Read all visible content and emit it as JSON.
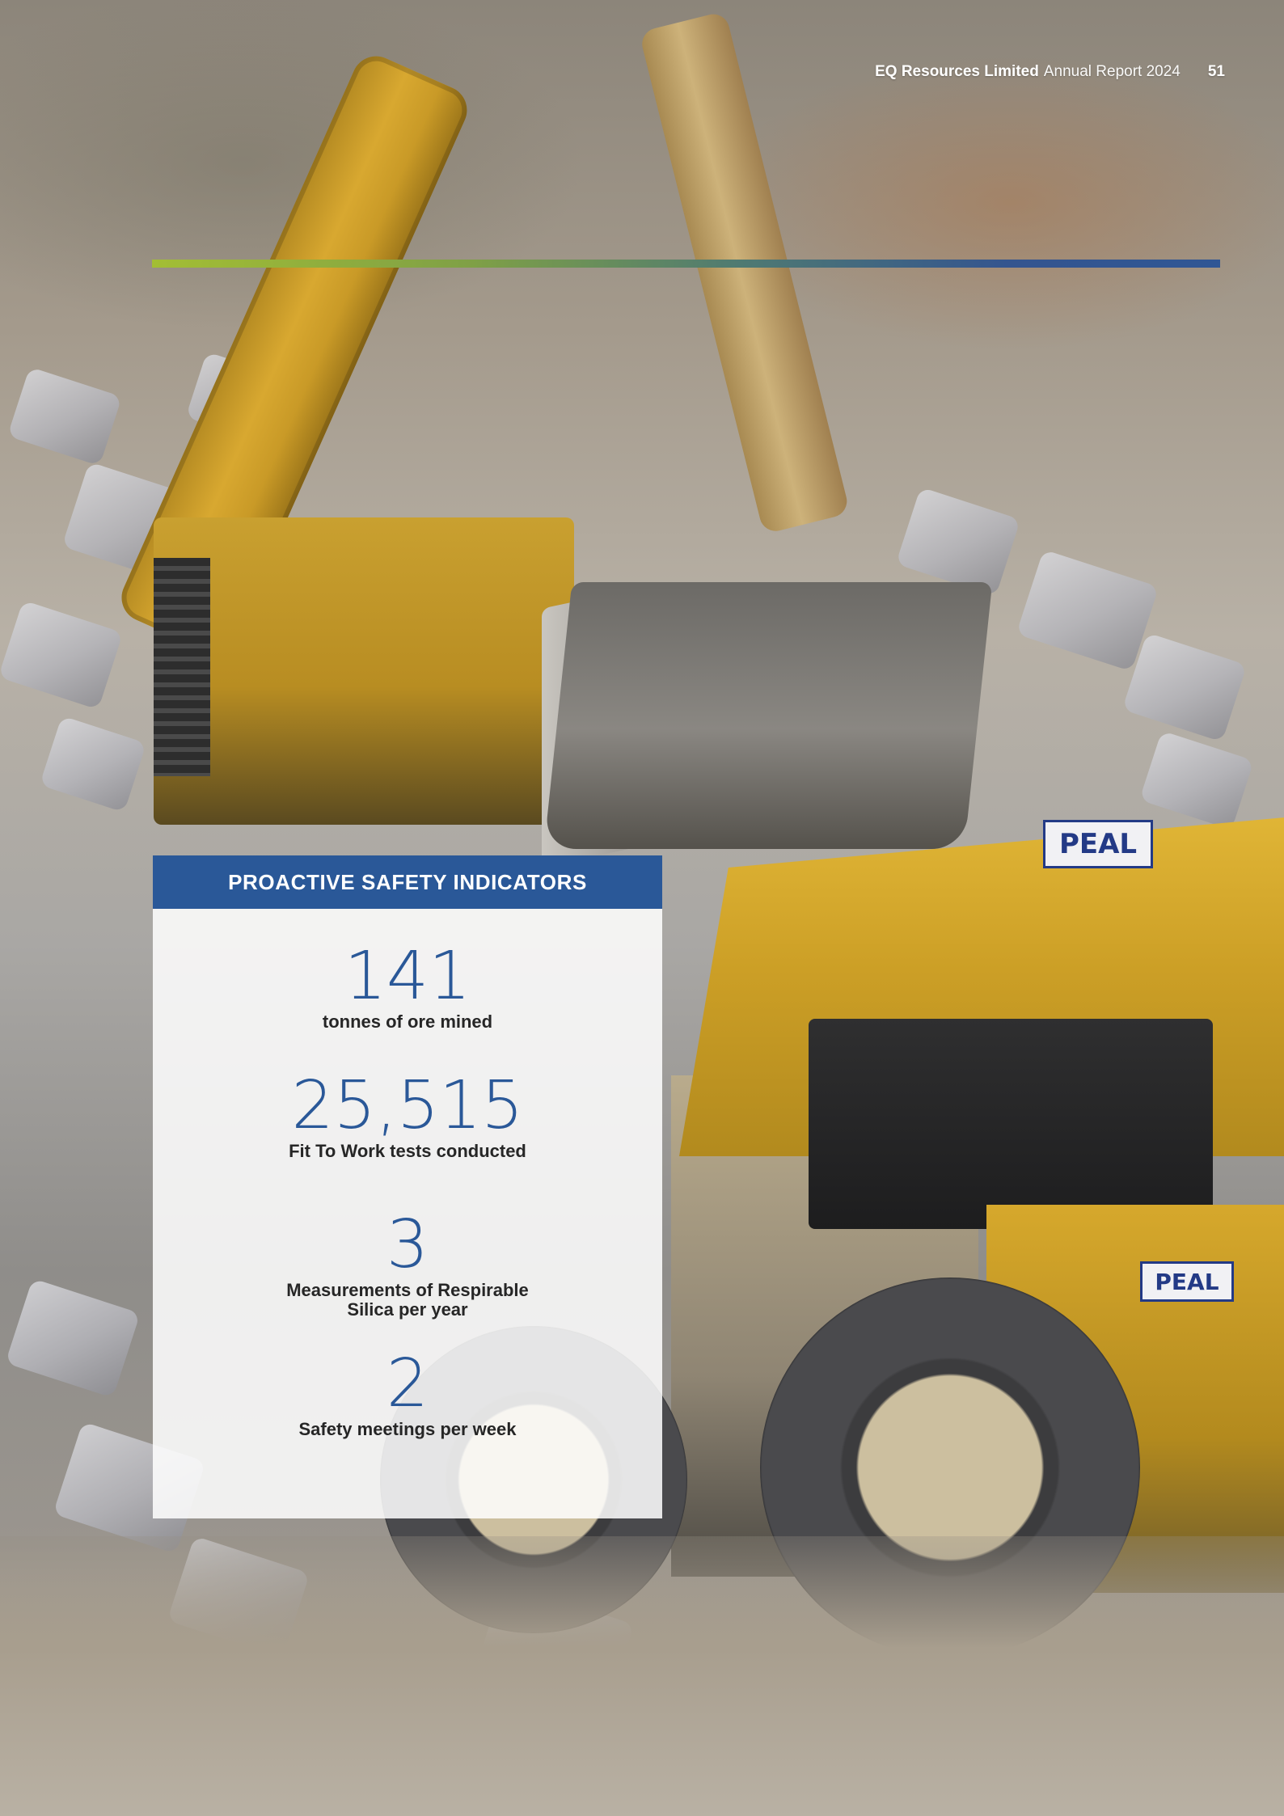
{
  "header": {
    "company": "EQ Resources Limited",
    "report": "Annual Report 2024",
    "page_number": "51"
  },
  "photo": {
    "brand_labels": [
      "PEAL",
      "PEAL"
    ],
    "colors": {
      "accent_green": "#a3be34",
      "accent_blue": "#2a5898",
      "machine_yellow": "#d8a830"
    }
  },
  "panel": {
    "title": "PROACTIVE SAFETY INDICATORS",
    "stats": [
      {
        "value": "141",
        "label": "tonnes of ore mined"
      },
      {
        "value": "25,515",
        "label": "Fit To Work tests conducted"
      },
      {
        "value": "3",
        "label_line1": "Measurements of Respirable",
        "label_line2": "Silica per year"
      },
      {
        "value": "2",
        "label": "Safety meetings per week"
      }
    ]
  }
}
